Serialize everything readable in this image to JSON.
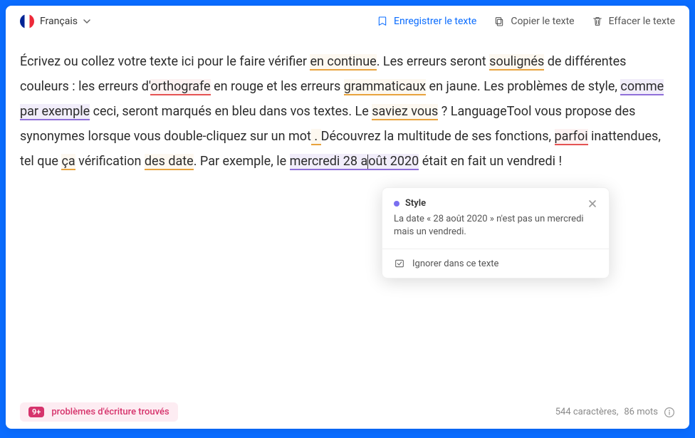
{
  "toolbar": {
    "language": "Français",
    "save_label": "Enregistrer le texte",
    "copy_label": "Copier le texte",
    "clear_label": "Effacer le texte"
  },
  "text": {
    "p1": "Écrivez ou collez votre texte ici pour le faire vérifier ",
    "err1": "en continue",
    "p2": ". Les erreurs seront ",
    "err2": "soulignés",
    "p3": " de différentes couleurs : les erreurs d'",
    "err3": "orthografe",
    "p4": " en rouge et les erreurs ",
    "err4": "grammaticaux",
    "p5": " en jaune. Les problèmes de style, ",
    "err5": "comme par exemple",
    "p6": " ceci, seront marqués en bleu dans vos textes. Le ",
    "err6": "saviez vous",
    "p7": " ? LanguageTool vous propose des synonymes lorsque vous double-cliquez sur un mot",
    "err7": " . ",
    "p8": " Découvrez la multitude de ses fonctions, ",
    "err8": "parfoi",
    "p9": " inattendues, tel que ",
    "err9": "ça",
    "p10": " vérification ",
    "err10": "des date",
    "p11": ". Par exemple, le ",
    "err11a": "mercredi 28 a",
    "err11b": "oût 2020",
    "p12": " était en fait un vendredi !"
  },
  "popup": {
    "category": "Style",
    "message": "La date « 28 août 2020 » n'est pas un mercredi mais un vendredi.",
    "ignore_label": "Ignorer dans ce texte"
  },
  "footer": {
    "count_badge": "9+",
    "issues_label": "problèmes d'écriture trouvés",
    "chars_label": "544 caractères,",
    "words_label": "86 mots"
  },
  "colors": {
    "accent": "#0a6cff",
    "error_red": "#e55353",
    "error_yellow": "#e8a33d",
    "error_purple": "#8f6fd9",
    "badge_pink": "#d6336c"
  }
}
